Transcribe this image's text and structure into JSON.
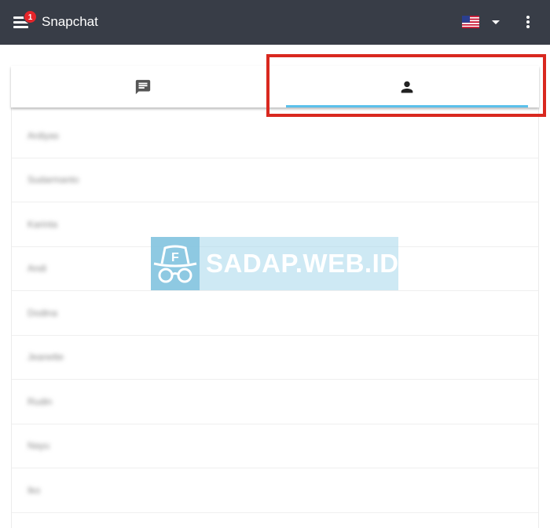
{
  "app": {
    "title": "Snapchat",
    "notification_count": "1"
  },
  "header": {
    "language_flag": "us-flag-icon",
    "dropdown_icon": "caret-down-icon",
    "more_icon": "more-vert-icon"
  },
  "tabs": [
    {
      "icon": "chat-message-icon",
      "selected": false
    },
    {
      "icon": "person-icon",
      "selected": true
    }
  ],
  "contacts": [
    "Ardiyas",
    "Sudarmanto",
    "Karinta",
    "Andi",
    "Dodina",
    "Jeanette",
    "Rudin",
    "Nayu",
    "Iko"
  ],
  "watermark": {
    "text": "SADAP.WEB.ID",
    "logo_letter": "F"
  },
  "colors": {
    "appbar": "#383d47",
    "badge": "#e5252a",
    "tab_indicator": "#5bc0eb",
    "highlight_box": "#d9281f"
  }
}
